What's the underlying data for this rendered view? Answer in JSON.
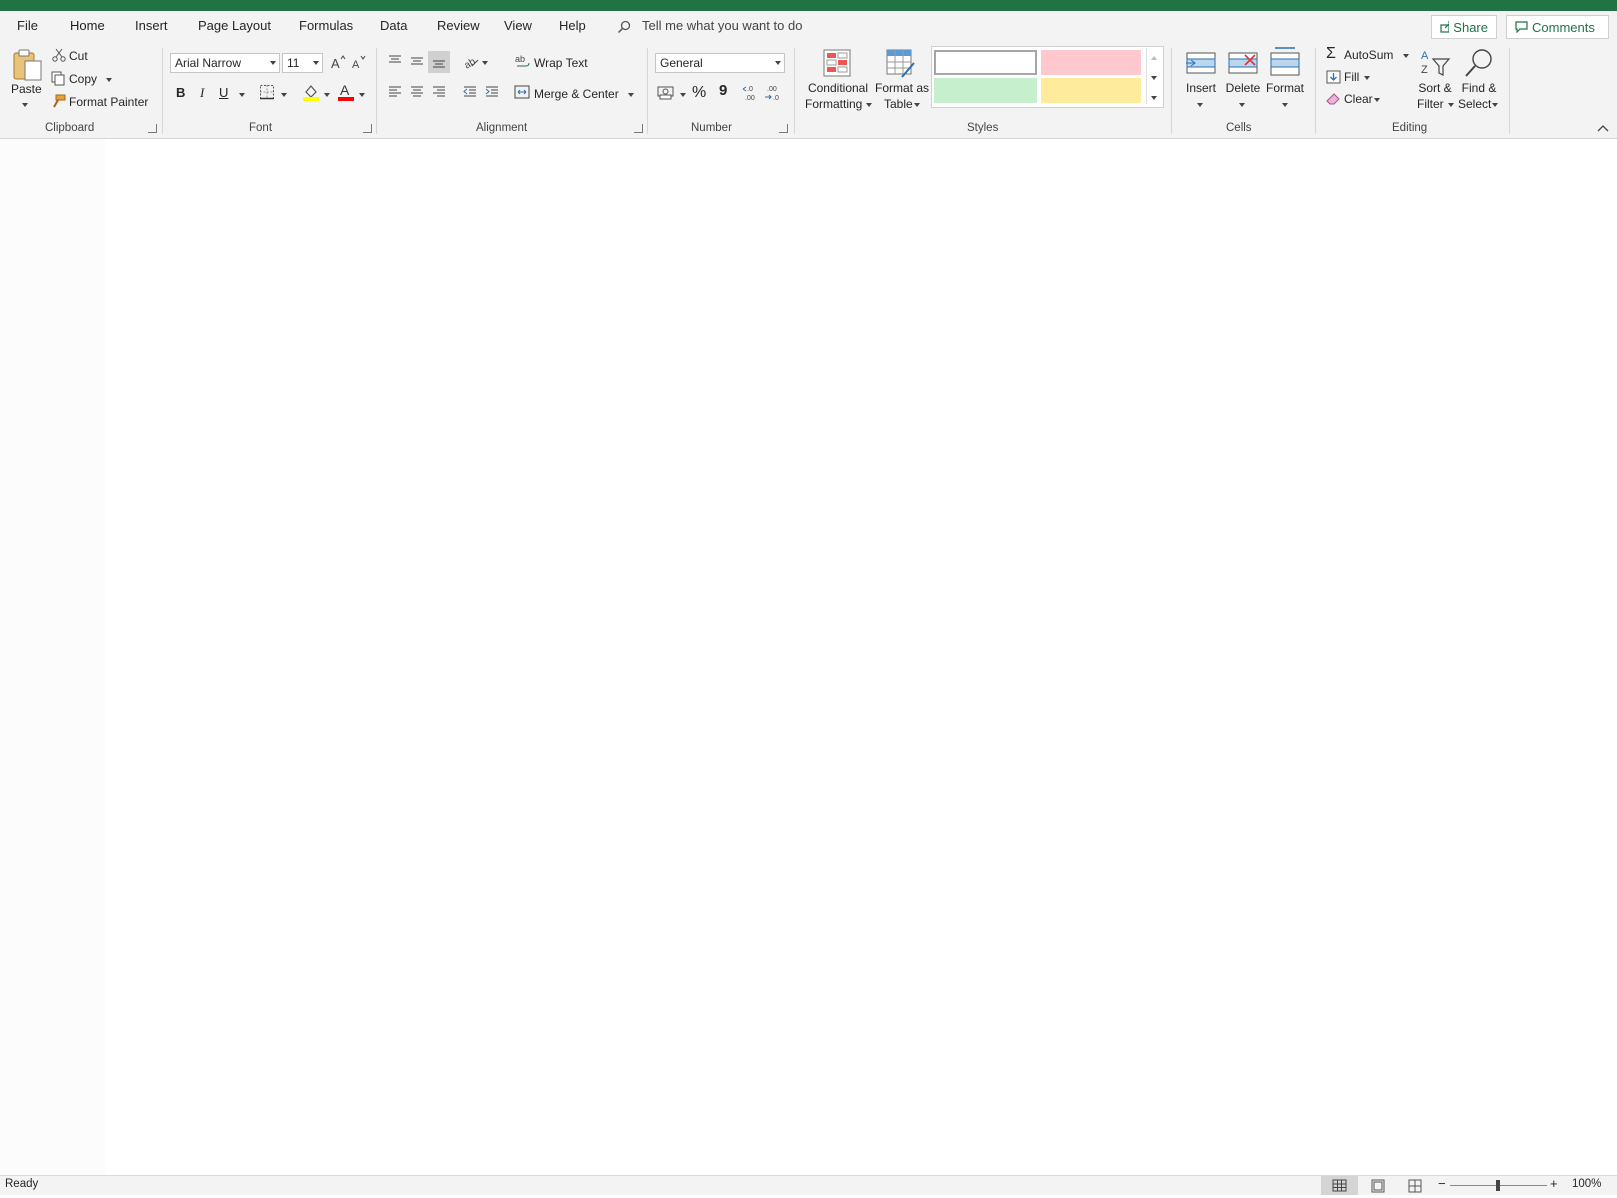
{
  "app": {
    "accent": "#217346"
  },
  "tabs": [
    "File",
    "Home",
    "Insert",
    "Page Layout",
    "Formulas",
    "Data",
    "Review",
    "View",
    "Help"
  ],
  "active_tab": "Home",
  "tell_me": "Tell me what you want to do",
  "top_buttons": {
    "share": "Share",
    "comments": "Comments"
  },
  "clipboard": {
    "paste": "Paste",
    "cut": "Cut",
    "copy": "Copy",
    "format_painter": "Format Painter",
    "label": "Clipboard"
  },
  "font": {
    "family": "Arial Narrow",
    "size": "11",
    "bold": "B",
    "italic": "I",
    "underline": "U",
    "font_color_glyph": "A",
    "label": "Font",
    "highlight_color": "#ffff00",
    "font_color": "#ff0000"
  },
  "alignment": {
    "wrap_text": "Wrap Text",
    "merge_center": "Merge & Center",
    "label": "Alignment"
  },
  "number": {
    "format": "General",
    "percent": "%",
    "comma": "9",
    "increase_decimal": "←.0 .00",
    "decrease_decimal": ".00 →.0",
    "label": "Number"
  },
  "styles": {
    "conditional_formatting": [
      "Conditional",
      "Formatting"
    ],
    "format_as_table": [
      "Format as",
      "Table"
    ],
    "label": "Styles",
    "swatches": [
      "#ffffff",
      "#ffc7ce",
      "#c6efce",
      "#ffeb9c"
    ]
  },
  "cells": {
    "insert": "Insert",
    "delete": "Delete",
    "format": "Format",
    "label": "Cells"
  },
  "editing": {
    "autosum": "AutoSum",
    "fill": "Fill",
    "clear": "Clear",
    "sort_filter": [
      "Sort &",
      "Filter"
    ],
    "find_select": [
      "Find &",
      "Select"
    ],
    "label": "Editing"
  },
  "status": {
    "ready": "Ready",
    "zoom": "100%",
    "zoom_minus": "−",
    "zoom_plus": "+"
  }
}
